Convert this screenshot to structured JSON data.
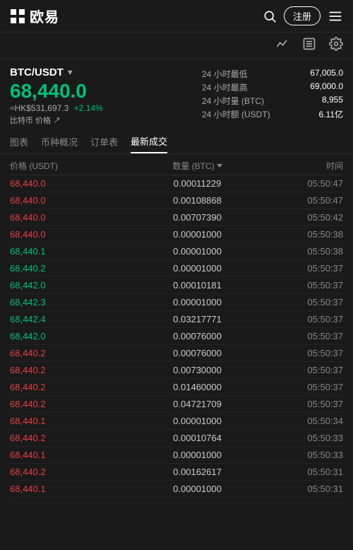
{
  "header": {
    "logo_text": "欧易",
    "register_label": "注册",
    "search_label": "搜索"
  },
  "pair": {
    "name": "BTC/USDT",
    "price": "68,440.0",
    "hk_equiv": "≈HK$531,697.3",
    "change": "+2.14%",
    "link_label": "比特币 价格 ↗",
    "stats": [
      {
        "label": "24 小时最低",
        "value": "67,005.0"
      },
      {
        "label": "24 小时最高",
        "value": "69,000.0"
      },
      {
        "label": "24 小时量 (BTC)",
        "value": "8,955"
      },
      {
        "label": "24 小时额 (USDT)",
        "value": "6.11亿"
      }
    ]
  },
  "tabs": [
    {
      "label": "图表",
      "active": false
    },
    {
      "label": "币种概况",
      "active": false
    },
    {
      "label": "订单表",
      "active": false
    },
    {
      "label": "最新成交",
      "active": true
    }
  ],
  "table": {
    "col_price": "价格 (USDT)",
    "col_qty": "数量 (BTC)",
    "col_time": "时间",
    "rows": [
      {
        "price": "68,440.0",
        "color": "red",
        "qty": "0.00011229",
        "time": "05:50:47"
      },
      {
        "price": "68,440.0",
        "color": "red",
        "qty": "0.00108868",
        "time": "05:50:47"
      },
      {
        "price": "68,440.0",
        "color": "red",
        "qty": "0.00707390",
        "time": "05:50:42"
      },
      {
        "price": "68,440.0",
        "color": "red",
        "qty": "0.00001000",
        "time": "05:50:38"
      },
      {
        "price": "68,440.1",
        "color": "green",
        "qty": "0.00001000",
        "time": "05:50:38"
      },
      {
        "price": "68,440.2",
        "color": "green",
        "qty": "0.00001000",
        "time": "05:50:37"
      },
      {
        "price": "68,442.0",
        "color": "green",
        "qty": "0.00010181",
        "time": "05:50:37"
      },
      {
        "price": "68,442.3",
        "color": "green",
        "qty": "0.00001000",
        "time": "05:50:37"
      },
      {
        "price": "68,442.4",
        "color": "green",
        "qty": "0.03217771",
        "time": "05:50:37"
      },
      {
        "price": "68,442.0",
        "color": "green",
        "qty": "0.00076000",
        "time": "05:50:37"
      },
      {
        "price": "68,440.2",
        "color": "red",
        "qty": "0.00076000",
        "time": "05:50:37"
      },
      {
        "price": "68,440.2",
        "color": "red",
        "qty": "0.00730000",
        "time": "05:50:37"
      },
      {
        "price": "68,440.2",
        "color": "red",
        "qty": "0.01460000",
        "time": "05:50:37"
      },
      {
        "price": "68,440.2",
        "color": "red",
        "qty": "0.04721709",
        "time": "05:50:37"
      },
      {
        "price": "68,440.1",
        "color": "red",
        "qty": "0.00001000",
        "time": "05:50:34"
      },
      {
        "price": "68,440.2",
        "color": "red",
        "qty": "0.00010764",
        "time": "05:50:33"
      },
      {
        "price": "68,440.1",
        "color": "red",
        "qty": "0.00001000",
        "time": "05:50:33"
      },
      {
        "price": "68,440.2",
        "color": "red",
        "qty": "0.00162617",
        "time": "05:50:31"
      },
      {
        "price": "68,440.1",
        "color": "red",
        "qty": "0.00001000",
        "time": "05:50:31"
      }
    ]
  }
}
